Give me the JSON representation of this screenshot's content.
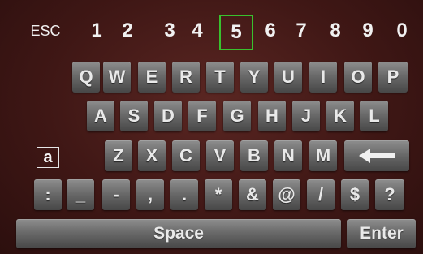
{
  "keyboard": {
    "top_row": {
      "esc": "ESC",
      "digits": [
        "1",
        "2",
        "3",
        "4",
        "5",
        "6",
        "7",
        "8",
        "9",
        "0"
      ],
      "selected": "5"
    },
    "row_qwerty": [
      "Q",
      "W",
      "E",
      "R",
      "T",
      "Y",
      "U",
      "I",
      "O",
      "P"
    ],
    "row_asdf": [
      "A",
      "S",
      "D",
      "F",
      "G",
      "H",
      "J",
      "K",
      "L"
    ],
    "row_zxcv": [
      "Z",
      "X",
      "C",
      "V",
      "B",
      "N",
      "M"
    ],
    "mode_toggle": "a",
    "backspace_icon": "left-arrow-icon",
    "symbols": [
      ":",
      "_",
      "-",
      ",",
      ".",
      "*",
      "&",
      "@",
      "/",
      "$",
      "?"
    ],
    "space": "Space",
    "enter": "Enter"
  }
}
